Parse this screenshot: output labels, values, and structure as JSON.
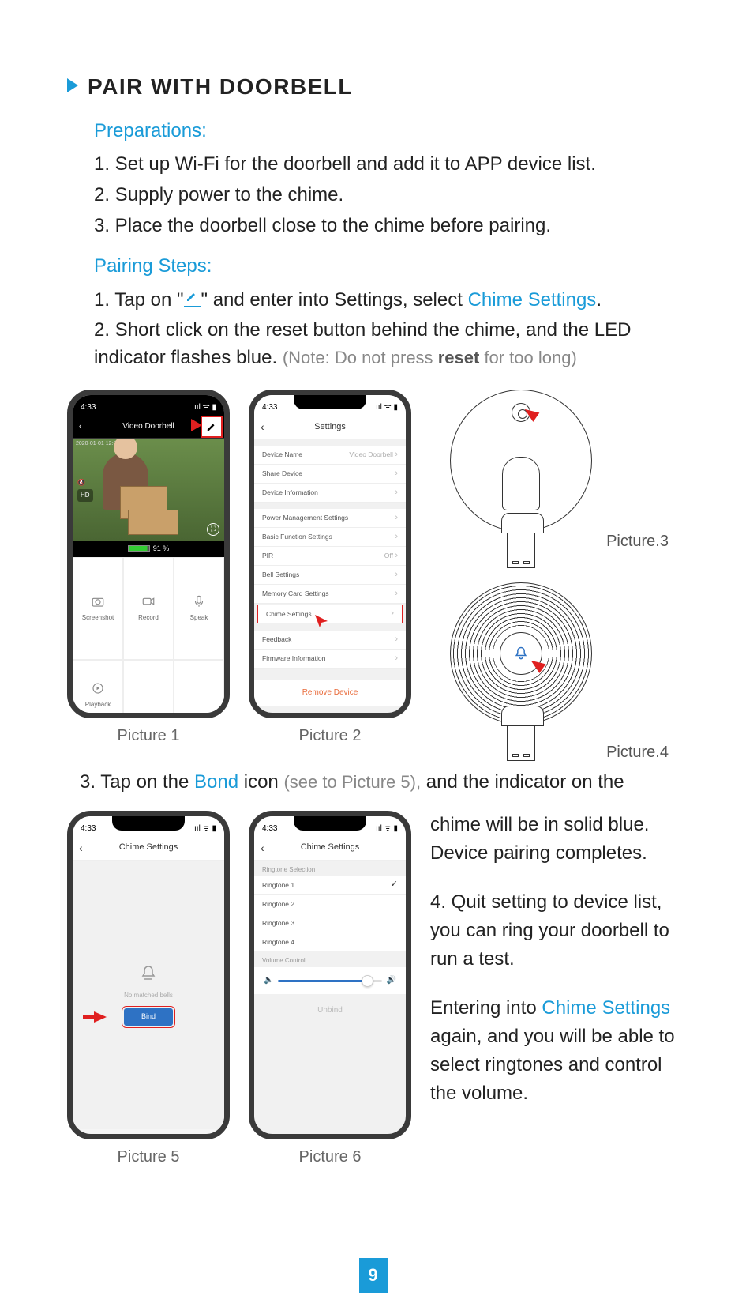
{
  "heading": "PAIR WITH DOORBELL",
  "preparations_label": "Preparations:",
  "preparations": [
    "1. Set up Wi-Fi for the doorbell and add it to APP device list.",
    "2. Supply power to the chime.",
    "3. Place the doorbell close to the chime before pairing."
  ],
  "pairing_steps_label": "Pairing Steps:",
  "step1_pre": "1. Tap on \"",
  "step1_post": "\" and enter into Settings, select ",
  "step1_link": "Chime Settings",
  "step1_end": ".",
  "step2_a": "2. Short click on the reset button behind the chime, and the LED indicator flashes blue. ",
  "step2_note_prefix": "(Note: Do not press ",
  "step2_reset": "reset",
  "step2_note_suffix": " for too long)",
  "captions": {
    "p1": "Picture 1",
    "p2": "Picture 2",
    "p3": "Picture.3",
    "p4": "Picture.4",
    "p5": "Picture 5",
    "p6": "Picture 6"
  },
  "phone_status_time": "4:33",
  "phone_status_icons": "ııl ᯤ ▮",
  "picture1": {
    "title": "Video Doorbell",
    "hd": "HD",
    "battery": "91 %",
    "buttons": {
      "screenshot": "Screenshot",
      "record": "Record",
      "speak": "Speak",
      "playback": "Playback"
    }
  },
  "picture2": {
    "title": "Settings",
    "rows": {
      "device_name": "Device Name",
      "device_name_val": "Video Doorbell",
      "share_device": "Share Device",
      "device_info": "Device Information",
      "power_mgmt": "Power Management Settings",
      "basic_func": "Basic Function Settings",
      "pir": "PIR",
      "pir_val": "Off",
      "bell": "Bell Settings",
      "memory": "Memory Card Settings",
      "chime": "Chime Settings",
      "feedback": "Feedback",
      "firmware": "Firmware Information",
      "remove": "Remove Device"
    }
  },
  "step3_pre": "3. Tap on the ",
  "step3_bond": "Bond",
  "step3_mid1": " icon ",
  "step3_see": "(see to Picture 5),",
  "step3_mid2": " and the  indicator on the ",
  "side": {
    "p3a": "chime will be in solid blue.  Device pairing completes.",
    "p4": "4. Quit setting to device list, you can ring your doorbell to run a test.",
    "p5_pre": "Entering into ",
    "p5_link": "Chime Settings",
    "p5_post": " again, and you will be able to select ringtones and  control the volume."
  },
  "picture5": {
    "title": "Chime Settings",
    "no_match": "No matched bells",
    "bind": "Bind"
  },
  "picture6": {
    "title": "Chime Settings",
    "ringtone_section": "Ringtone Selection",
    "r1": "Ringtone 1",
    "r2": "Ringtone 2",
    "r3": "Ringtone 3",
    "r4": "Ringtone 4",
    "volume_section": "Volume Control",
    "unbind": "Unbind"
  },
  "page_number": "9"
}
